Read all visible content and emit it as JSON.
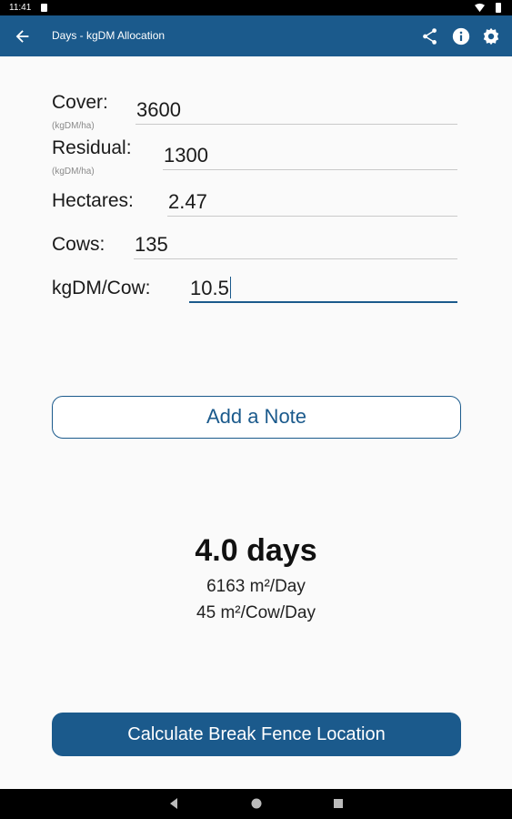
{
  "status_bar": {
    "time": "11:41"
  },
  "app_bar": {
    "title": "Days - kgDM Allocation"
  },
  "fields": [
    {
      "label": "Cover:",
      "unit": "(kgDM/ha)",
      "value": "3600"
    },
    {
      "label": "Residual:",
      "unit": "(kgDM/ha)",
      "value": "1300"
    },
    {
      "label": "Hectares:",
      "unit": "",
      "value": "2.47"
    },
    {
      "label": "Cows:",
      "unit": "",
      "value": "135"
    },
    {
      "label": "kgDM/Cow:",
      "unit": "",
      "value": "10.5"
    }
  ],
  "note_button": {
    "label": "Add a Note"
  },
  "result": {
    "days": "4.0 days",
    "area_per_day": "6163 m²/Day",
    "area_per_cow_per_day": "45 m²/Cow/Day"
  },
  "calculate_button": {
    "label": "Calculate Break Fence Location"
  },
  "colors": {
    "primary": "#1b5a8c",
    "background": "#fafafa"
  }
}
